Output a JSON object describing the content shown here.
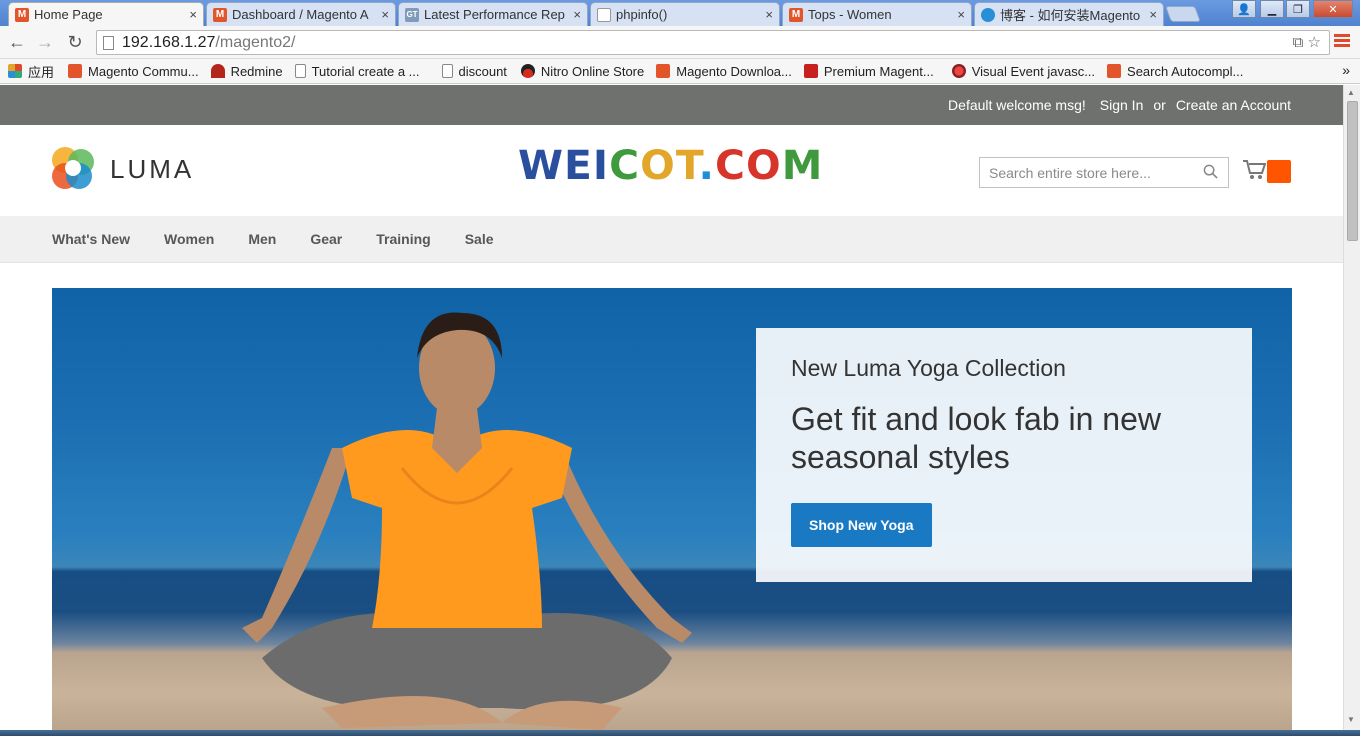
{
  "browser": {
    "tabs": [
      {
        "title": "Home Page",
        "icon": "magento-icon",
        "active": true
      },
      {
        "title": "Dashboard / Magento A",
        "icon": "magento-icon"
      },
      {
        "title": "Latest Performance Rep",
        "icon": "gtmetrix-icon"
      },
      {
        "title": "phpinfo()",
        "icon": "document-icon"
      },
      {
        "title": "Tops - Women",
        "icon": "magento-icon"
      },
      {
        "title": "博客 - 如何安装Magento",
        "icon": "blog-icon"
      }
    ],
    "close_glyph": "×",
    "url_host": "192.168.1.27",
    "url_path": "/magento2/",
    "bookmarks": [
      {
        "label": "应用",
        "icon": "apps-grid-icon"
      },
      {
        "label": "Magento Commu...",
        "icon": "magento-icon"
      },
      {
        "label": "Redmine",
        "icon": "redmine-icon"
      },
      {
        "label": "Tutorial create a ...",
        "icon": "document-icon"
      },
      {
        "label": "discount",
        "icon": "document-icon"
      },
      {
        "label": "Nitro Online Store",
        "icon": "nitro-icon"
      },
      {
        "label": "Magento Downloa...",
        "icon": "magento-icon"
      },
      {
        "label": "Premium Magent...",
        "icon": "premium-icon"
      },
      {
        "label": "Visual Event javasc...",
        "icon": "visual-event-icon"
      },
      {
        "label": "Search Autocompl...",
        "icon": "magento-icon"
      }
    ]
  },
  "page": {
    "welcome": "Default welcome msg!",
    "sign_in": "Sign In",
    "or": "or",
    "create_account": "Create an Account",
    "logo_text": "LUMA",
    "brand_letters": [
      {
        "ch": "W",
        "color": "#2a4f9e"
      },
      {
        "ch": "E",
        "color": "#2a4f9e"
      },
      {
        "ch": "I",
        "color": "#2a4f9e"
      },
      {
        "ch": "C",
        "color": "#3f9a3d"
      },
      {
        "ch": "O",
        "color": "#e2a62b"
      },
      {
        "ch": "T",
        "color": "#e2a62b"
      },
      {
        "ch": ".",
        "color": "#1e8fd6"
      },
      {
        "ch": "C",
        "color": "#d8352a"
      },
      {
        "ch": "O",
        "color": "#d8352a"
      },
      {
        "ch": "M",
        "color": "#3f9a3d"
      }
    ],
    "search_placeholder": "Search entire store here...",
    "nav": [
      "What's New",
      "Women",
      "Men",
      "Gear",
      "Training",
      "Sale"
    ],
    "hero": {
      "subtitle": "New Luma Yoga Collection",
      "title": "Get fit and look fab in new seasonal styles",
      "button": "Shop New Yoga"
    }
  }
}
